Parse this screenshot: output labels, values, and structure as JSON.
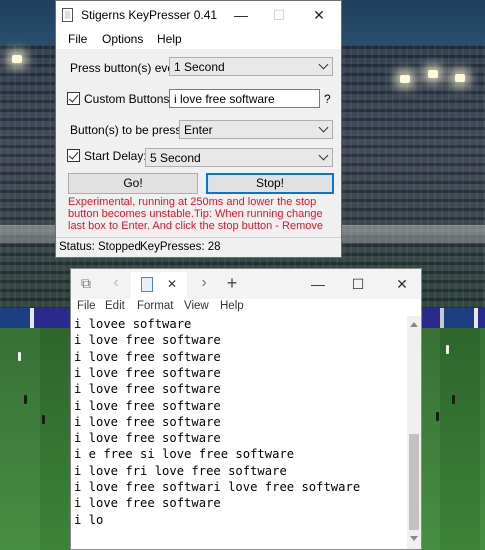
{
  "keypresser": {
    "title": "Stigerns KeyPresser 0.41",
    "window_controls": {
      "minimize": "—",
      "maximize": "☐",
      "close": "✕"
    },
    "menu": [
      "File",
      "Options",
      "Help"
    ],
    "press_every": {
      "label": "Press button(s) every:",
      "value": "1 Second"
    },
    "custom_buttons": {
      "label": "Custom Buttons:",
      "value": "i love free software",
      "checked": true,
      "help": "?"
    },
    "to_press": {
      "label": "Button(s) to be pressed:",
      "value": "Enter"
    },
    "start_delay": {
      "label": "Start Delay:",
      "value": "5 Second",
      "checked": true
    },
    "go_label": "Go!",
    "stop_label": "Stop!",
    "note": "Experimental, running at 250ms and lower the stop button becomes unstable.Tip: When running change last box to Enter. And click the stop button - Remove",
    "status": {
      "state": "Status: Stopped",
      "count": "KeyPresses: 28"
    }
  },
  "notepad": {
    "tab_new": "+",
    "tab_close": "✕",
    "nav_back": "‹",
    "nav_forward": "›",
    "controls": {
      "minimize": "—",
      "maximize": "☐",
      "close": "✕"
    },
    "menu": [
      "File",
      "Edit",
      "Format",
      "View",
      "Help"
    ],
    "lines": [
      "i lovee software",
      "i love free software",
      "i love free software",
      "i love free software",
      "i love free software",
      "i love free software",
      "i love free software",
      "i love free software",
      "i e free si love free software",
      "i love fri love free software",
      "i love free softwari love free software",
      "i love free software",
      "i lo"
    ]
  }
}
